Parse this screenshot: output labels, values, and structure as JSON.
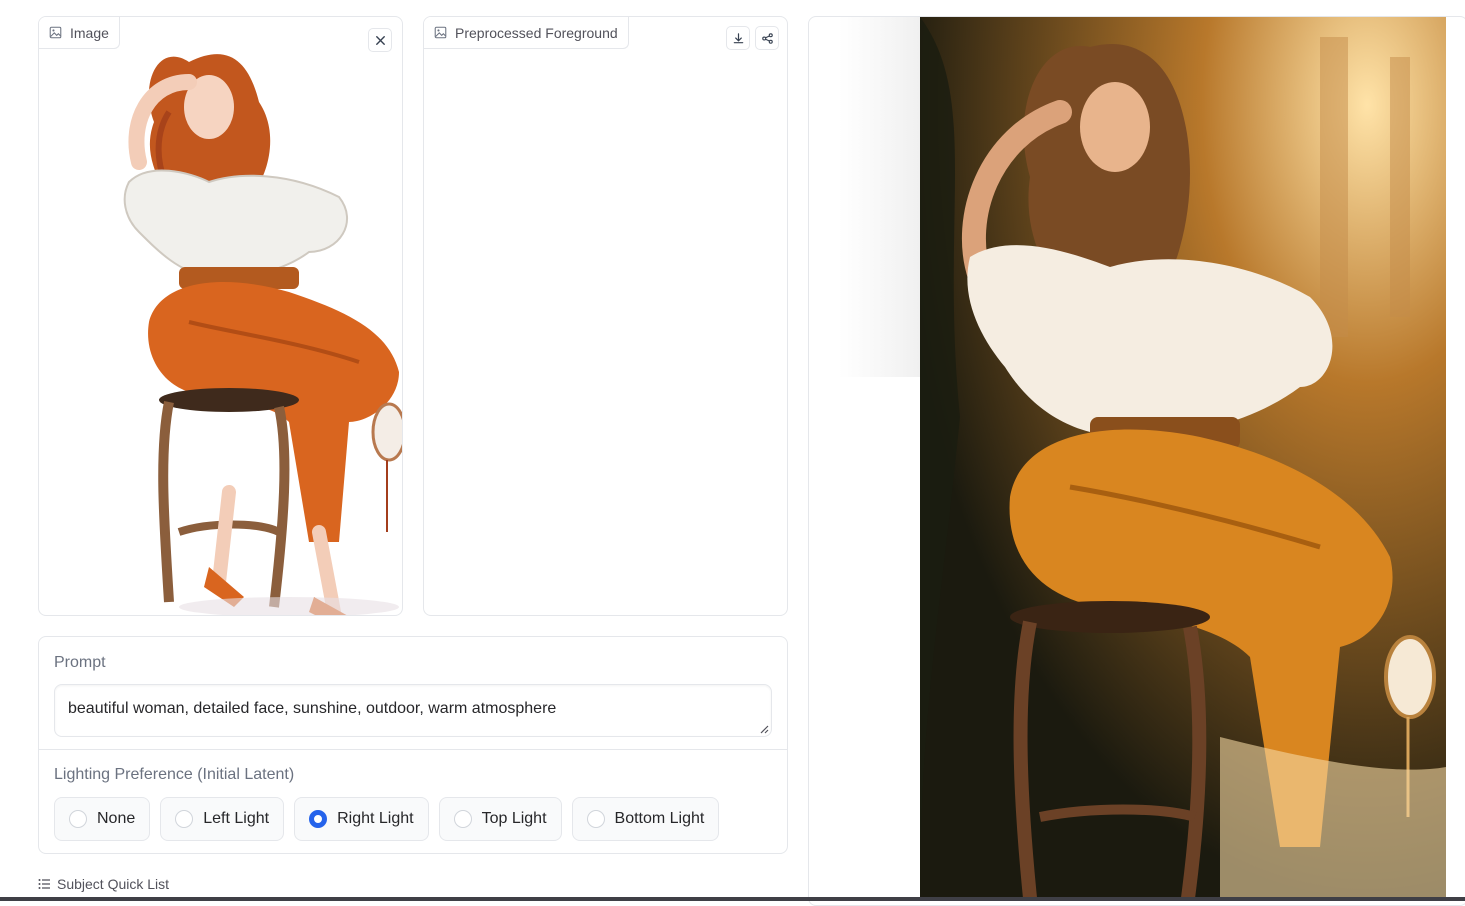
{
  "input_panel": {
    "label": "Image",
    "label_icon": "image-icon",
    "clear_icon": "close-icon"
  },
  "foreground_panel": {
    "label": "Preprocessed Foreground",
    "label_icon": "image-icon",
    "download_icon": "download-icon",
    "share_icon": "share-icon"
  },
  "prompt": {
    "label": "Prompt",
    "value": "beautiful woman, detailed face, sunshine, outdoor, warm atmosphere"
  },
  "lighting": {
    "label": "Lighting Preference (Initial Latent)",
    "options": [
      "None",
      "Left Light",
      "Right Light",
      "Top Light",
      "Bottom Light"
    ],
    "selected": "Right Light"
  },
  "quick_list": {
    "label": "Subject Quick List",
    "icon": "list-icon"
  },
  "colors": {
    "accent": "#2563eb",
    "border": "#e5e7eb"
  }
}
